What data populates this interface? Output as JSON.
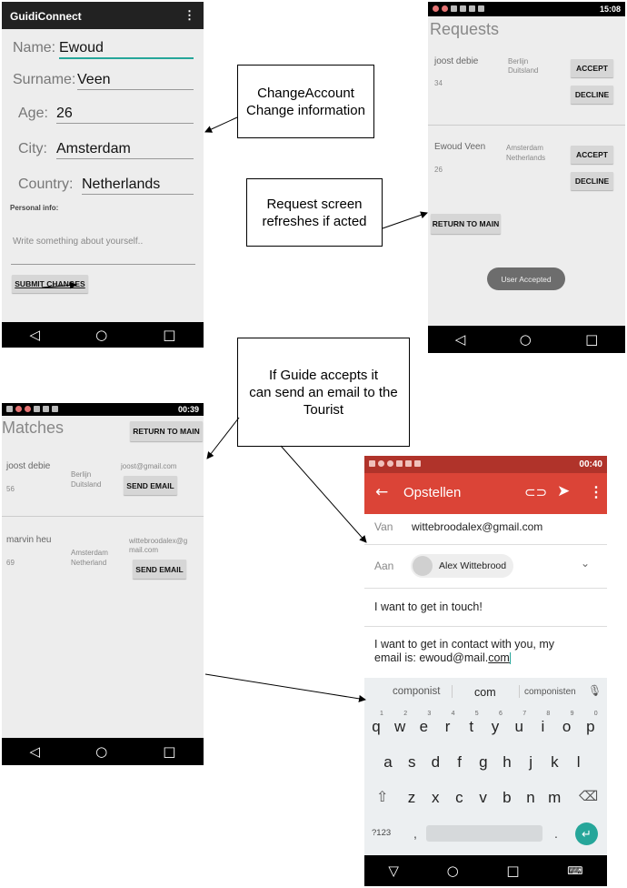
{
  "account_screen": {
    "app_title": "GuidiConnect",
    "menu_glyph": "⋮",
    "fields": [
      {
        "label": "Name:",
        "value": "Ewoud"
      },
      {
        "label": "Surname:",
        "value": "Veen"
      },
      {
        "label": "Age:",
        "value": "26"
      },
      {
        "label": "City:",
        "value": "Amsterdam"
      },
      {
        "label": "Country:",
        "value": "Netherlands"
      }
    ],
    "personal_info_label": "Personal info:",
    "personal_info_placeholder": "Write something about yourself..",
    "submit_label": "SUBMIT CHANGES"
  },
  "requests_screen": {
    "status_time": "15:08",
    "title": "Requests",
    "requests": [
      {
        "name": "joost debie",
        "age": "34",
        "city": "Berlijn",
        "country": "Duitsland"
      },
      {
        "name": "Ewoud Veen",
        "age": "26",
        "city": "Amsterdam",
        "country": "Netherlands"
      }
    ],
    "accept_label": "ACCEPT",
    "decline_label": "DECLINE",
    "return_label": "RETURN TO MAIN",
    "toast": "User Accepted"
  },
  "matches_screen": {
    "status_time": "00:39",
    "title": "Matches",
    "return_label": "RETURN TO MAIN",
    "matches": [
      {
        "name": "joost debie",
        "age": "56",
        "city": "Berlijn",
        "country": "Duitsland",
        "email": "joost@gmail.com"
      },
      {
        "name": "marvin heu",
        "age": "69",
        "city": "Amsterdam",
        "country": "Netherland",
        "email_line1": "wittebroodalex@g",
        "email_line2": "mail.com"
      }
    ],
    "send_label": "SEND EMAIL"
  },
  "email_screen": {
    "status_time": "00:40",
    "toolbar_title": "Opstellen",
    "from_label": "Van",
    "from_value": "wittebroodalex@gmail.com",
    "to_label": "Aan",
    "to_value": "Alex Wittebrood",
    "subject": "I want to get in touch!",
    "body_line1": "I want to get in contact with you, my",
    "body_line2_prefix": "email is: ewoud@mail.",
    "body_line2_suffix": "com",
    "suggestions": [
      "componist",
      "com",
      "componisten"
    ],
    "keyboard_row1": [
      "q",
      "w",
      "e",
      "r",
      "t",
      "y",
      "u",
      "i",
      "o",
      "p"
    ],
    "keyboard_row1_nums": [
      "1",
      "2",
      "3",
      "4",
      "5",
      "6",
      "7",
      "8",
      "9",
      "0"
    ],
    "keyboard_row2": [
      "a",
      "s",
      "d",
      "f",
      "g",
      "h",
      "j",
      "k",
      "l"
    ],
    "keyboard_row3": [
      "z",
      "x",
      "c",
      "v",
      "b",
      "n",
      "m"
    ],
    "sym_key": "?123",
    "comma_key": ",",
    "period_key": "."
  },
  "annotations": {
    "change_account": [
      "ChangeAccount",
      "Change information"
    ],
    "request_refresh": [
      "Request screen",
      "refreshes if acted"
    ],
    "guide_email": [
      "If Guide accepts it",
      "can send an email to the",
      "Tourist"
    ]
  },
  "nav": {
    "back": "◁",
    "home": "○",
    "recent": "□"
  },
  "colors": {
    "email_accent": "#db4437",
    "keyboard_bg": "#eceff1",
    "send_teal": "#26a69a"
  }
}
